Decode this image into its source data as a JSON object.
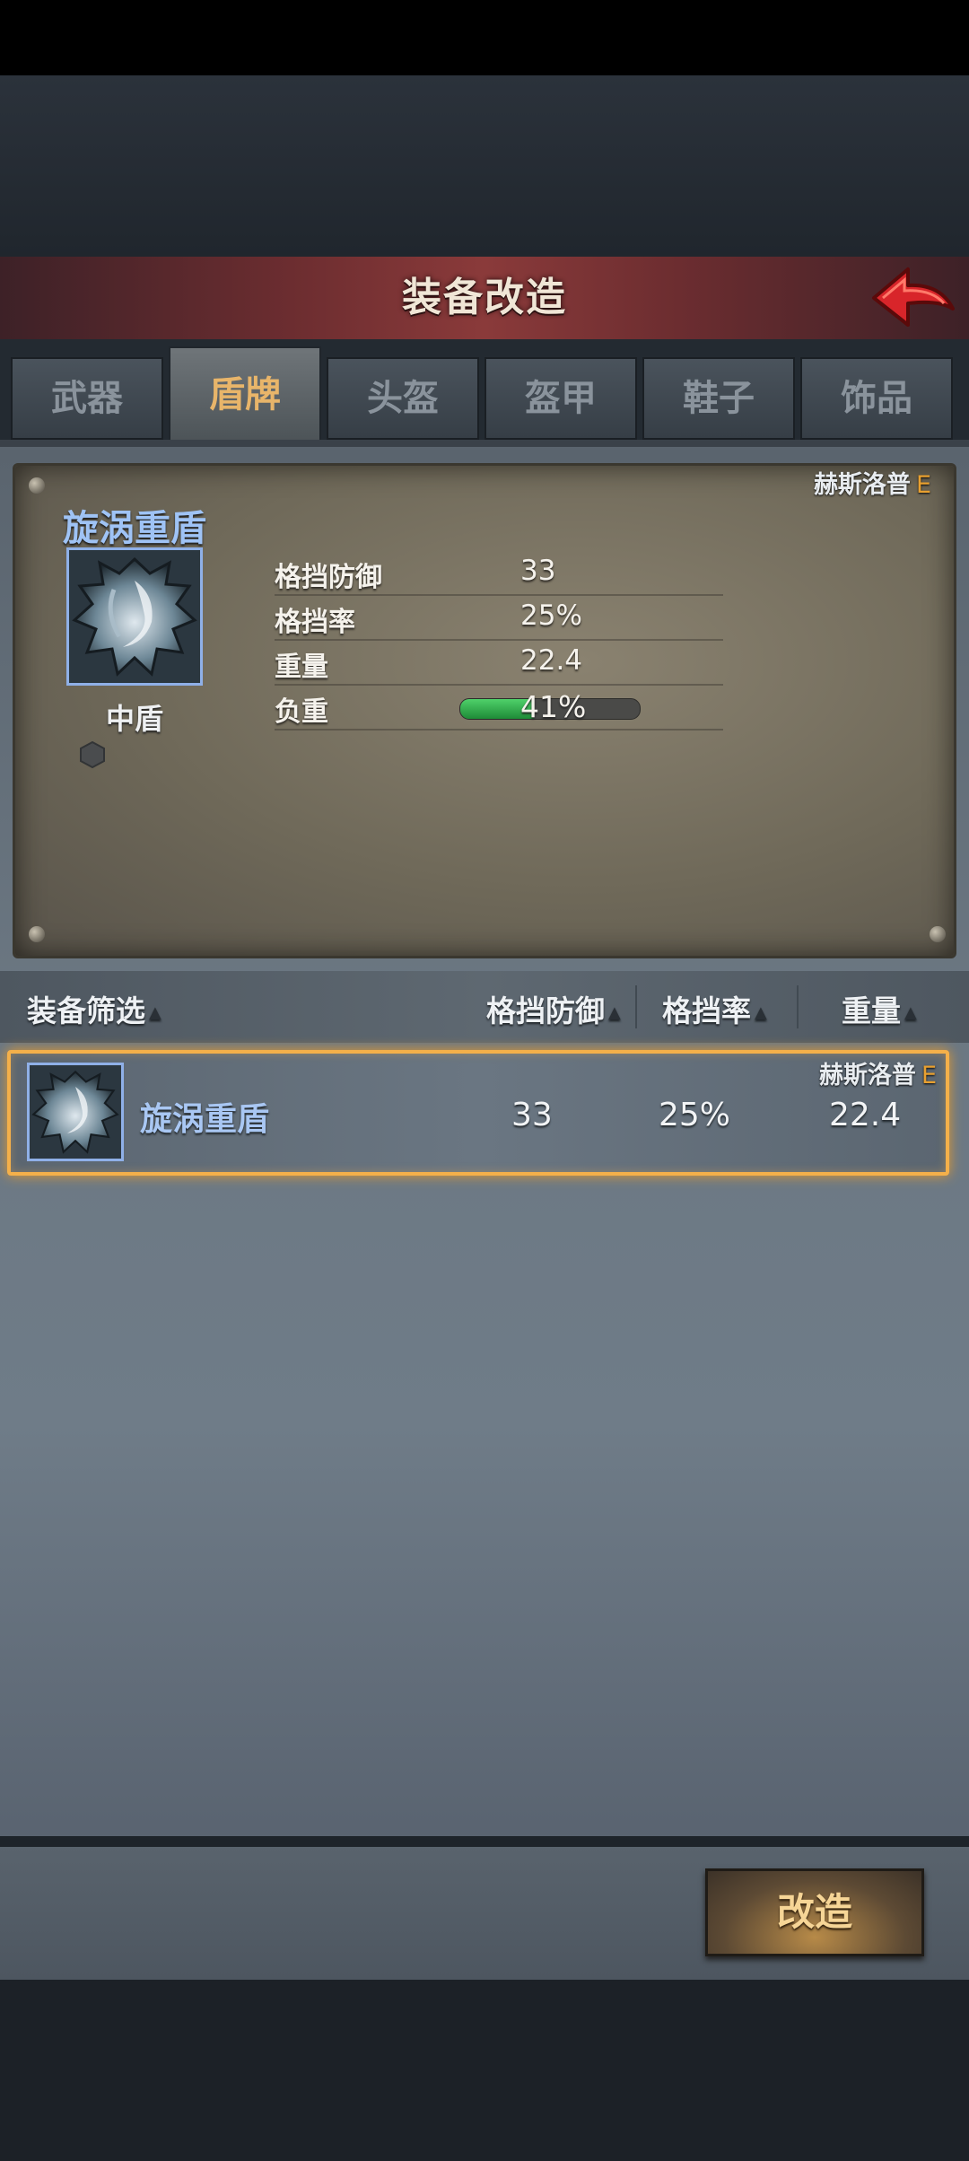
{
  "header": {
    "title": "装备改造"
  },
  "tabs": [
    {
      "label": "武器"
    },
    {
      "label": "盾牌",
      "active": true
    },
    {
      "label": "头盔"
    },
    {
      "label": "盔甲"
    },
    {
      "label": "鞋子"
    },
    {
      "label": "饰品"
    }
  ],
  "detail": {
    "source": "赫斯洛普",
    "grade": "E",
    "name": "旋涡重盾",
    "type": "中盾",
    "stats": [
      {
        "label": "格挡防御",
        "value": "33"
      },
      {
        "label": "格挡率",
        "value": "25%"
      },
      {
        "label": "重量",
        "value": "22.4"
      },
      {
        "label": "负重",
        "value": "41%"
      }
    ],
    "load_fraction": 0.41
  },
  "filter": {
    "label": "装备筛选",
    "col_block_def": "格挡防御",
    "col_block_rate": "格挡率",
    "col_weight": "重量",
    "arrow": "▲"
  },
  "list": [
    {
      "name": "旋涡重盾",
      "block_def": "33",
      "block_rate": "25%",
      "weight": "22.4",
      "source": "赫斯洛普",
      "grade": "E"
    }
  ],
  "footer": {
    "button_label": "改造"
  },
  "colors": {
    "accent": "#e8a030",
    "item_name_blue": "#9fc3f5",
    "selection": "#f4b04a",
    "load_green": "#3cb956"
  },
  "icons": [
    "back-arrow-icon",
    "shield-icon",
    "gem-slot-icon",
    "sort-arrow-icon"
  ]
}
